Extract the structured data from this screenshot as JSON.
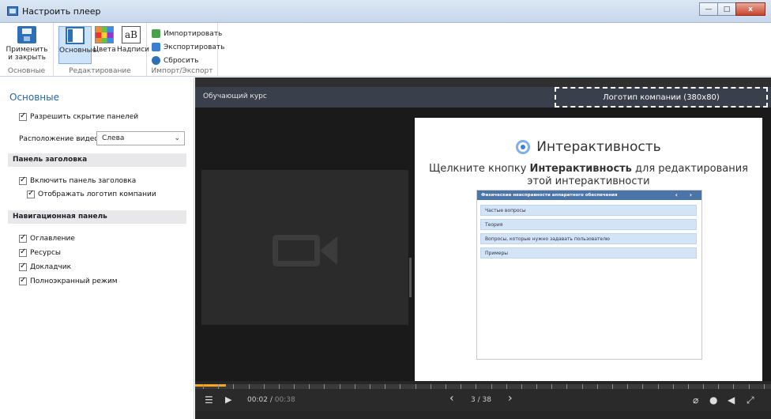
{
  "window": {
    "title": "Настроить плеер",
    "min": "—",
    "max": "□",
    "close": "x"
  },
  "ribbon": {
    "apply_close": "Применить и закрыть",
    "basic": "Основные",
    "colors": "Цвета",
    "captions": "Надписи",
    "import": "Импортировать",
    "export": "Экспортировать",
    "reset": "Сбросить",
    "text_icon": "aB",
    "groups": {
      "basic": "Основные",
      "edit": "Редактирование",
      "importexport": "Импорт/Экспорт"
    }
  },
  "left": {
    "title": "Основные",
    "allow_hide_panels": "Разрешить скрытие панелей",
    "video_position_label": "Расположение видео:",
    "video_position_value": "Слева",
    "header_panel": "Панель заголовка",
    "enable_header": "Включить панель заголовка",
    "show_logo": "Отображать логотип компании",
    "nav_panel": "Навигационная панель",
    "nav_items": [
      "Оглавление",
      "Ресурсы",
      "Докладчик",
      "Полноэкранный режим"
    ]
  },
  "player": {
    "course_title": "Обучающий курс",
    "logo_placeholder": "Логотип компании (380x80)",
    "slide": {
      "heading": "Интерактивность",
      "line1_pre": "Щелкните кнопку ",
      "line1_bold": "Интерактивность",
      "line1_post": " для редактирования",
      "line2": "этой интерактивности",
      "panel_title": "Физические неисправности аппаратного обеспечения",
      "panel_arrows": "‹ ›",
      "items": [
        "Частые вопросы",
        "Теория",
        "Вопросы, которые нужно задавать пользователю",
        "Примеры"
      ]
    },
    "time_current": "00:02",
    "time_sep": "/",
    "time_total": "00:38",
    "page_current": "3",
    "page_sep": "/",
    "page_total": "38",
    "progress_fraction": 0.053
  }
}
